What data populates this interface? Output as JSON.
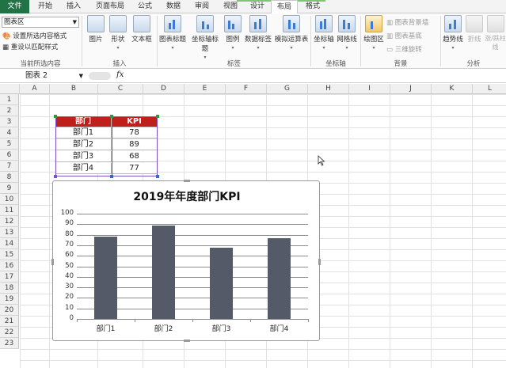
{
  "tabs": [
    "文件",
    "开始",
    "插入",
    "页面布局",
    "公式",
    "数据",
    "审阅",
    "视图",
    "设计",
    "布局",
    "格式"
  ],
  "ribbon": {
    "combo_value": "图表区",
    "cmd_format_selection": "设置所选内容格式",
    "cmd_reset_style": "重设以匹配样式",
    "group_current": "当前所选内容",
    "btn_picture": "图片",
    "btn_shapes": "形状",
    "btn_textbox": "文本框",
    "group_insert": "插入",
    "btn_chart_title": "图表标题",
    "btn_axis_titles": "坐标轴标题",
    "btn_legend": "图例",
    "btn_data_labels": "数据标签",
    "btn_data_table": "模拟运算表",
    "group_labels": "标签",
    "btn_axes": "坐标轴",
    "btn_gridlines": "网格线",
    "group_axes": "坐标轴",
    "btn_plot_area": "绘图区",
    "cmd_chart_wall": "图表背景墙",
    "cmd_chart_floor": "图表基底",
    "cmd_3d_rotation": "三维旋转",
    "group_background": "背景",
    "btn_trendline": "趋势线",
    "btn_lines": "折线",
    "btn_updown_bars": "涨/跌柱线",
    "group_analysis": "分析"
  },
  "formula_bar": {
    "name_box": "图表 2",
    "fx": "fx"
  },
  "columns": [
    "A",
    "B",
    "C",
    "D",
    "E",
    "F",
    "G",
    "H",
    "I",
    "J",
    "K",
    "L"
  ],
  "rows": [
    "1",
    "2",
    "3",
    "4",
    "5",
    "6",
    "7",
    "8",
    "9",
    "10",
    "11",
    "12",
    "13",
    "14",
    "15",
    "16",
    "17",
    "18",
    "19",
    "20",
    "21",
    "22",
    "23"
  ],
  "table": {
    "headers": [
      "部门",
      "KPI"
    ],
    "rows": [
      [
        "部门1",
        "78"
      ],
      [
        "部门2",
        "89"
      ],
      [
        "部门3",
        "68"
      ],
      [
        "部门4",
        "77"
      ]
    ]
  },
  "colors": {
    "header_fill": "#c0201b",
    "bar_fill": "#545a68",
    "excel_green": "#217346"
  },
  "chart_data": {
    "type": "bar",
    "title": "2019年年度部门KPI",
    "categories": [
      "部门1",
      "部门2",
      "部门3",
      "部门4"
    ],
    "values": [
      78,
      89,
      68,
      77
    ],
    "ylim": [
      0,
      100
    ],
    "yticks": [
      "0",
      "10",
      "20",
      "30",
      "40",
      "50",
      "60",
      "70",
      "80",
      "90",
      "100"
    ],
    "grid": true,
    "legend": "none"
  }
}
